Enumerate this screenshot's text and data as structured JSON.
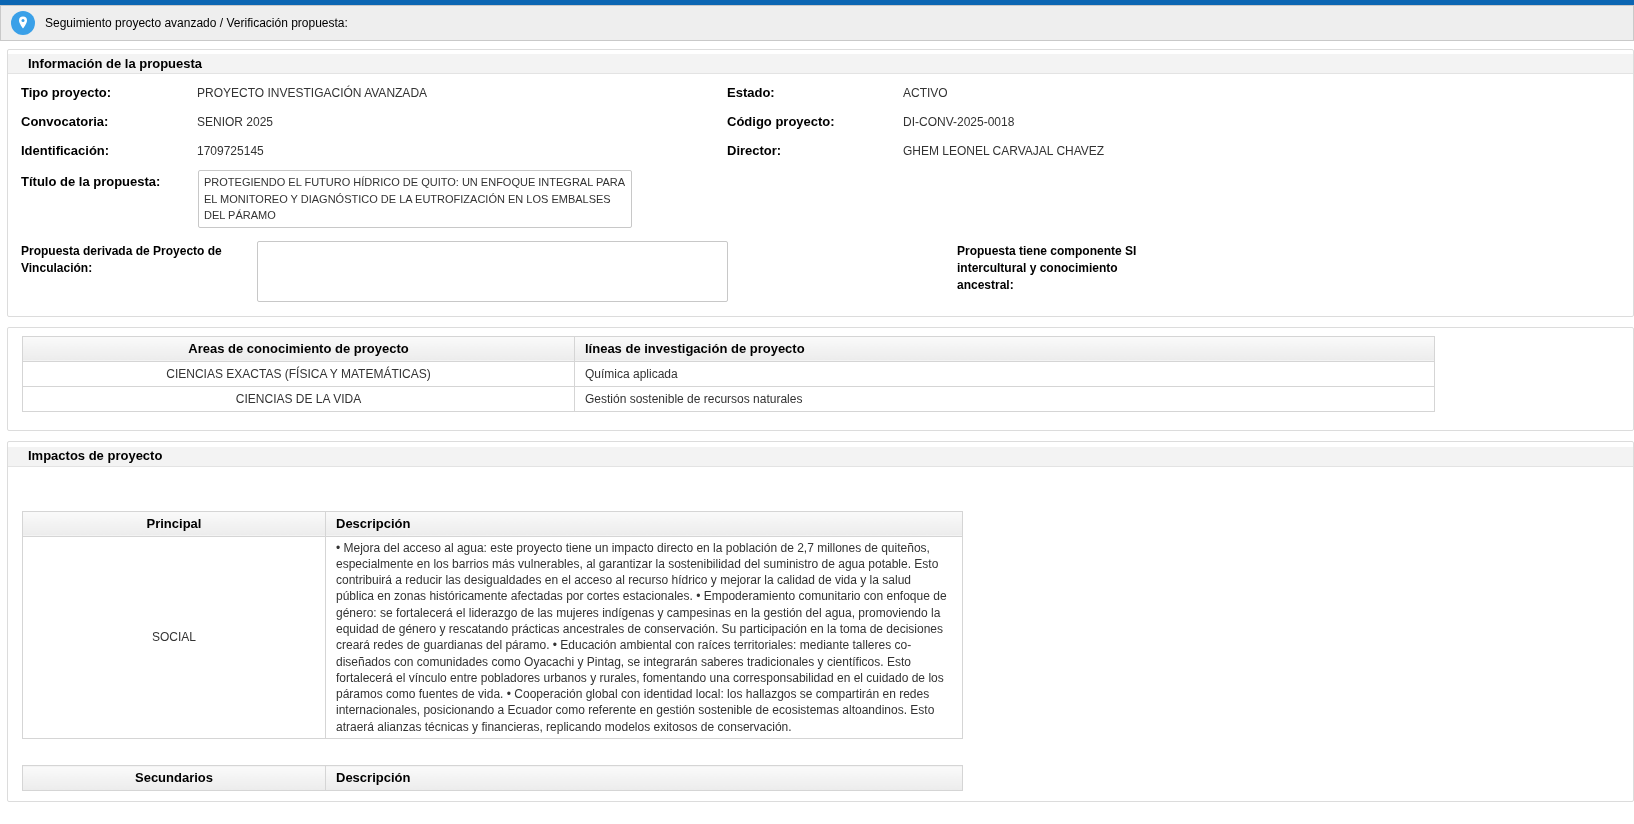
{
  "breadcrumb": "Seguimiento proyecto avanzado / Verificación propuesta:",
  "info": {
    "title": "Información de la propuesta",
    "left_fields": [
      {
        "label": "Tipo proyecto:",
        "value": "PROYECTO INVESTIGACIÓN AVANZADA"
      },
      {
        "label": "Convocatoria:",
        "value": "SENIOR 2025"
      },
      {
        "label": "Identificación:",
        "value": "1709725145"
      }
    ],
    "right_fields": [
      {
        "label": "Estado:",
        "value": "ACTIVO"
      },
      {
        "label": "Código proyecto:",
        "value": "DI-CONV-2025-0018"
      },
      {
        "label": "Director:",
        "value": "GHEM LEONEL CARVAJAL CHAVEZ"
      }
    ],
    "proposal_title": {
      "label": "Título de la propuesta:",
      "value": "PROTEGIENDO EL FUTURO HÍDRICO DE QUITO: UN ENFOQUE INTEGRAL PARA EL MONITOREO Y DIAGNÓSTICO DE LA EUTROFIZACIÓN EN LOS EMBALSES DEL PÁRAMO"
    },
    "vinculacion": {
      "label": "Propuesta derivada de Proyecto de Vinculación:"
    },
    "intercultural": {
      "label": "Propuesta tiene componente SI intercultural y conocimiento ancestral:"
    }
  },
  "areas_table": {
    "columns": [
      "Areas de conocimiento de proyecto",
      "líneas de investigación de proyecto"
    ],
    "rows": [
      [
        "CIENCIAS EXACTAS (FÍSICA Y MATEMÁTICAS)",
        "Química aplicada"
      ],
      [
        "CIENCIAS DE LA VIDA",
        "Gestión sostenible de recursos naturales"
      ]
    ]
  },
  "impacts": {
    "title": "Impactos de proyecto",
    "tables": [
      {
        "columns": [
          "Principal",
          "Descripción"
        ],
        "rows": [
          [
            "SOCIAL",
            "• Mejora del acceso al agua: este proyecto tiene un impacto directo en la población de 2,7 millones de quiteños, especialmente en los barrios más vulnerables, al garantizar la sostenibilidad del suministro de agua potable. Esto contribuirá a reducir las desigualdades en el acceso al recurso hídrico y mejorar la calidad de vida y la salud pública en zonas históricamente afectadas por cortes estacionales. • Empoderamiento comunitario con enfoque de género: se fortalecerá el liderazgo de las mujeres indígenas y campesinas en la gestión del agua, promoviendo la equidad de género y rescatando prácticas ancestrales de conservación. Su participación en la toma de decisiones creará redes de guardianas del páramo. • Educación ambiental con raíces territoriales: mediante talleres co-diseñados con comunidades como Oyacachi y Pintag, se integrarán saberes tradicionales y científicos. Esto fortalecerá el vínculo entre pobladores urbanos y rurales, fomentando una corresponsabilidad en el cuidado de los páramos como fuentes de vida. • Cooperación global con identidad local: los hallazgos se compartirán en redes internacionales, posicionando a Ecuador como referente en gestión sostenible de ecosistemas altoandinos. Esto atraerá alianzas técnicas y financieras, replicando modelos exitosos de conservación."
          ]
        ]
      },
      {
        "columns": [
          "Secundarios",
          "Descripción"
        ]
      }
    ]
  }
}
